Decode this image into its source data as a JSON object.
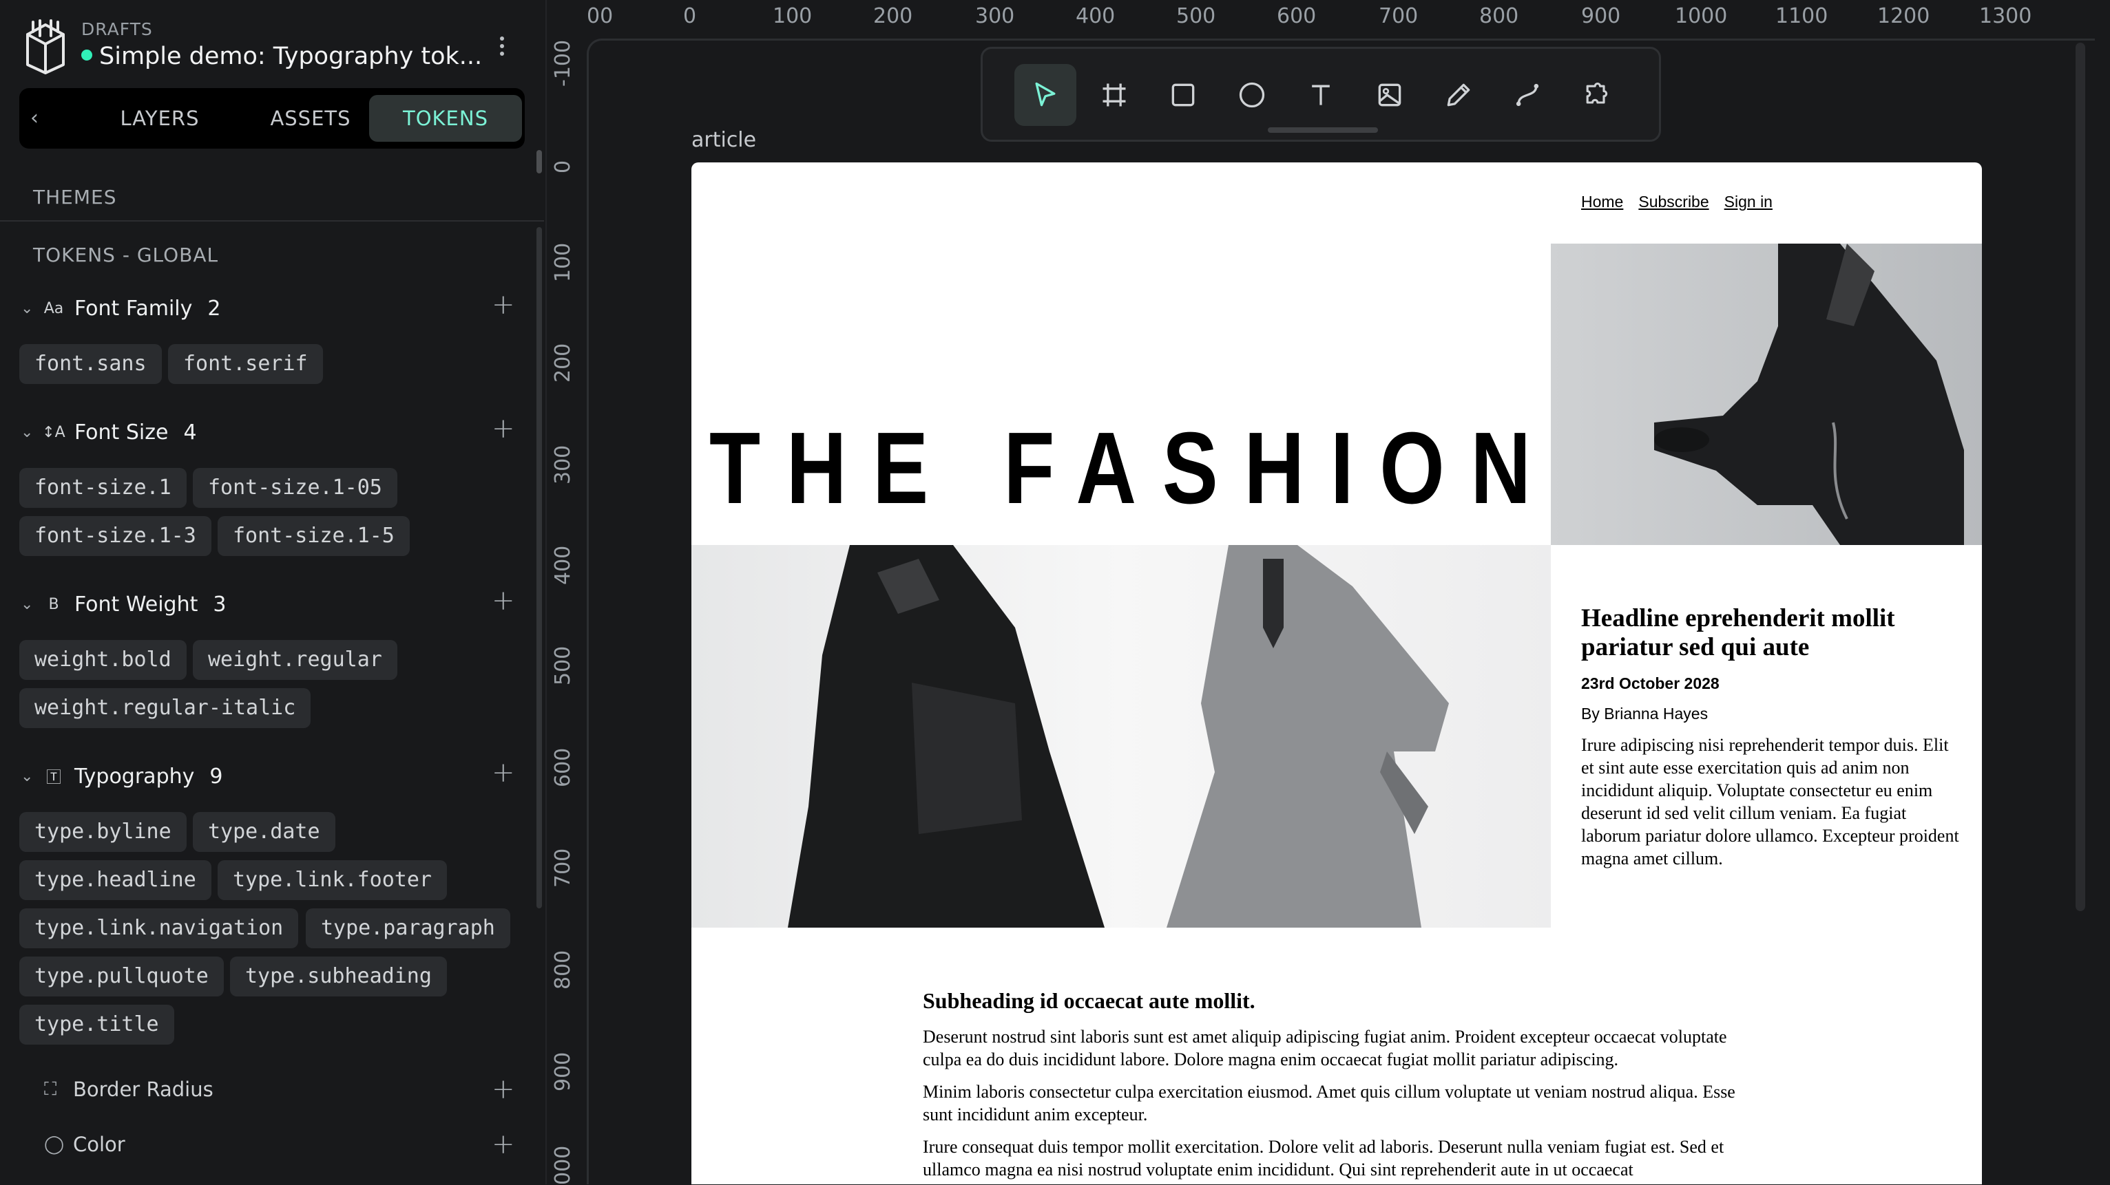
{
  "header": {
    "workspace": "DRAFTS",
    "project_title": "Simple demo: Typography tok..."
  },
  "tabs": [
    {
      "label": "LAYERS"
    },
    {
      "label": "ASSETS"
    },
    {
      "label": "TOKENS",
      "active": true
    }
  ],
  "sidebar": {
    "themes_label": "THEMES",
    "tokens_label": "TOKENS - GLOBAL",
    "groups": [
      {
        "label": "Font Family",
        "count": "2",
        "tokens": [
          "font.sans",
          "font.serif"
        ]
      },
      {
        "label": "Font Size",
        "count": "4",
        "tokens": [
          "font-size.1",
          "font-size.1-05",
          "font-size.1-3",
          "font-size.1-5"
        ]
      },
      {
        "label": "Font Weight",
        "count": "3",
        "tokens": [
          "weight.bold",
          "weight.regular",
          "weight.regular-italic"
        ]
      },
      {
        "label": "Typography",
        "count": "9",
        "tokens": [
          "type.byline",
          "type.date",
          "type.headline",
          "type.link.footer",
          "type.link.navigation",
          "type.paragraph",
          "type.pullquote",
          "type.subheading",
          "type.title"
        ]
      }
    ],
    "other_groups": [
      {
        "label": "Border Radius"
      },
      {
        "label": "Color"
      }
    ]
  },
  "ruler": {
    "x_ticks": [
      "00",
      "0",
      "100",
      "200",
      "300",
      "400",
      "500",
      "600",
      "700",
      "800",
      "900",
      "1000",
      "1100",
      "1200",
      "1300"
    ],
    "y_ticks": [
      "-100",
      "0",
      "100",
      "200",
      "300",
      "400",
      "500",
      "600",
      "700",
      "800",
      "900",
      "000"
    ]
  },
  "toolbar": {
    "tools": [
      "pointer-tool",
      "board-tool",
      "rectangle-tool",
      "ellipse-tool",
      "text-tool",
      "image-tool",
      "pencil-tool",
      "path-tool",
      "plugins-tool"
    ]
  },
  "board": {
    "label": "article",
    "nav": [
      "Home",
      "Subscribe",
      "Sign in"
    ],
    "title": "THE FASHION",
    "headline": "Headline eprehenderit mollit pariatur sed qui aute",
    "date": "23rd October 2028",
    "byline": "By Brianna Hayes",
    "side_paragraph": "Irure adipiscing nisi reprehenderit tempor duis. Elit et sint aute esse exercitation quis ad anim non incididunt aliquip. Voluptate consectetur eu enim deserunt id sed velit cillum veniam. Ea fugiat laborum pariatur dolore ullamco. Excepteur proident magna amet cillum.",
    "subheading": "Subheading id occaecat aute mollit.",
    "paragraphs": [
      "Deserunt nostrud sint laboris sunt est amet aliquip adipiscing fugiat anim. Proident excepteur occaecat voluptate culpa ea do duis incididunt labore. Dolore magna enim occaecat fugiat mollit pariatur adipiscing.",
      "Minim laboris consectetur culpa exercitation eiusmod. Amet quis cillum voluptate ut veniam nostrud aliqua. Esse sunt incididunt anim excepteur.",
      "Irure consequat duis tempor mollit exercitation. Dolore velit ad laboris. Deserunt nulla veniam fugiat est. Sed et ullamco magna ea nisi nostrud voluptate enim incididunt. Qui sint reprehenderit aute in ut occaecat"
    ]
  },
  "colors": {
    "accent": "#7cf2d6",
    "status_dot": "#31efb8",
    "panel_bg": "#18191b",
    "pill_bg": "#2a2c2f"
  }
}
